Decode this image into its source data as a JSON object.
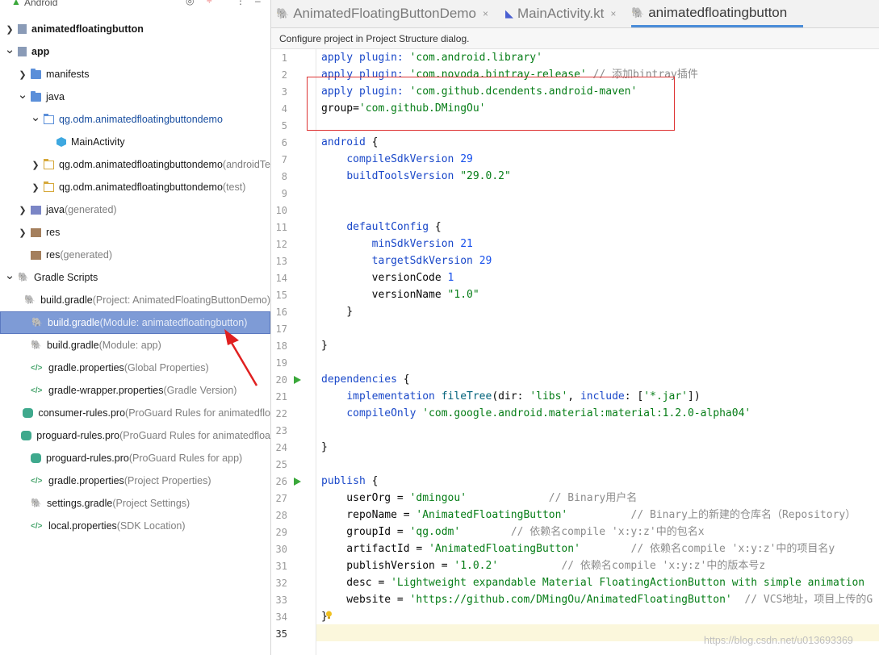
{
  "sidebar": {
    "header": "Android",
    "items": [
      {
        "label": "animatedfloatingbutton",
        "suffix": "",
        "arrow": ">",
        "icon": "module-icon",
        "bold": true
      },
      {
        "label": "app",
        "suffix": "",
        "arrow": "v",
        "icon": "module-icon",
        "bold": true
      },
      {
        "label": "manifests",
        "suffix": "",
        "arrow": ">",
        "icon": "folder-icon"
      },
      {
        "label": "java",
        "suffix": "",
        "arrow": "v",
        "icon": "folder-icon"
      },
      {
        "label": "qg.odm.animatedfloatingbuttondemo",
        "suffix": "",
        "arrow": "v",
        "icon": "package-icon",
        "blue": true
      },
      {
        "label": "MainActivity",
        "suffix": "",
        "arrow": "",
        "icon": "class-icon"
      },
      {
        "label": "qg.odm.animatedfloatingbuttondemo",
        "suffix": " (androidTe",
        "arrow": ">",
        "icon": "package-icon"
      },
      {
        "label": "qg.odm.animatedfloatingbuttondemo",
        "suffix": " (test)",
        "arrow": ">",
        "icon": "package-icon"
      },
      {
        "label": "java",
        "suffix": " (generated)",
        "arrow": ">",
        "icon": "folder-icon"
      },
      {
        "label": "res",
        "suffix": "",
        "arrow": ">",
        "icon": "res-folder-icon"
      },
      {
        "label": "res",
        "suffix": " (generated)",
        "arrow": "",
        "icon": "res-folder-icon"
      },
      {
        "label": "Gradle Scripts",
        "suffix": "",
        "arrow": "v",
        "icon": "gradle-icon"
      },
      {
        "label": "build.gradle",
        "suffix": " (Project: AnimatedFloatingButtonDemo)",
        "arrow": "",
        "icon": "gradle-icon"
      },
      {
        "label": "build.gradle",
        "suffix": " (Module: animatedfloatingbutton)",
        "arrow": "",
        "icon": "gradle-icon",
        "selected": true
      },
      {
        "label": "build.gradle",
        "suffix": " (Module: app)",
        "arrow": "",
        "icon": "gradle-icon"
      },
      {
        "label": "gradle.properties",
        "suffix": " (Global Properties)",
        "arrow": "",
        "icon": "properties-icon"
      },
      {
        "label": "gradle-wrapper.properties",
        "suffix": " (Gradle Version)",
        "arrow": "",
        "icon": "properties-icon"
      },
      {
        "label": "consumer-rules.pro",
        "suffix": " (ProGuard Rules for animatedflo",
        "arrow": "",
        "icon": "proguard-icon"
      },
      {
        "label": "proguard-rules.pro",
        "suffix": " (ProGuard Rules for animatedfloa",
        "arrow": "",
        "icon": "proguard-icon"
      },
      {
        "label": "proguard-rules.pro",
        "suffix": " (ProGuard Rules for app)",
        "arrow": "",
        "icon": "proguard-icon"
      },
      {
        "label": "gradle.properties",
        "suffix": " (Project Properties)",
        "arrow": "",
        "icon": "properties-icon"
      },
      {
        "label": "settings.gradle",
        "suffix": " (Project Settings)",
        "arrow": "",
        "icon": "gradle-icon"
      },
      {
        "label": "local.properties",
        "suffix": " (SDK Location)",
        "arrow": "",
        "icon": "properties-icon"
      }
    ]
  },
  "tabs": [
    {
      "label": "AnimatedFloatingButtonDemo",
      "icon": "gradle-icon",
      "active": false,
      "close": "×"
    },
    {
      "label": "MainActivity.kt",
      "icon": "kotlin-icon",
      "active": false,
      "close": "×"
    },
    {
      "label": "animatedfloatingbutton",
      "icon": "gradle-icon",
      "active": true,
      "close": ""
    }
  ],
  "hint": "Configure project in Project Structure dialog.",
  "editor": {
    "current_line": 35,
    "lines": [
      [
        [
          "kw",
          "apply plugin: "
        ],
        [
          "str",
          "'com.android.library'"
        ]
      ],
      [
        [
          "kw",
          "apply plugin: "
        ],
        [
          "str",
          "'com.novoda.bintray-release'"
        ],
        [
          "cmt",
          " // 添加bintray插件"
        ]
      ],
      [
        [
          "kw",
          "apply plugin: "
        ],
        [
          "str",
          "'com.github.dcendents.android-maven'"
        ]
      ],
      [
        [
          "",
          "group="
        ],
        [
          "str",
          "'com.github.DMingOu'"
        ]
      ],
      [],
      [
        [
          "kw",
          "android"
        ],
        [
          "",
          " {"
        ]
      ],
      [
        [
          "",
          "    "
        ],
        [
          "kw",
          "compileSdkVersion "
        ],
        [
          "num",
          "29"
        ]
      ],
      [
        [
          "",
          "    "
        ],
        [
          "kw",
          "buildToolsVersion "
        ],
        [
          "str",
          "\"29.0.2\""
        ]
      ],
      [],
      [],
      [
        [
          "",
          "    "
        ],
        [
          "kw",
          "defaultConfig"
        ],
        [
          "",
          " {"
        ]
      ],
      [
        [
          "",
          "        "
        ],
        [
          "kw",
          "minSdkVersion "
        ],
        [
          "num",
          "21"
        ]
      ],
      [
        [
          "",
          "        "
        ],
        [
          "kw",
          "targetSdkVersion "
        ],
        [
          "num",
          "29"
        ]
      ],
      [
        [
          "",
          "        versionCode "
        ],
        [
          "num",
          "1"
        ]
      ],
      [
        [
          "",
          "        versionName "
        ],
        [
          "str",
          "\"1.0\""
        ]
      ],
      [
        [
          "",
          "    }"
        ]
      ],
      [],
      [
        [
          "",
          "}"
        ]
      ],
      [],
      [
        [
          "kw",
          "dependencies"
        ],
        [
          "",
          " {"
        ]
      ],
      [
        [
          "",
          "    "
        ],
        [
          "kw",
          "implementation "
        ],
        [
          "fn",
          "fileTree"
        ],
        [
          "",
          "(dir: "
        ],
        [
          "str",
          "'libs'"
        ],
        [
          "",
          ", "
        ],
        [
          "kw",
          "include"
        ],
        [
          "",
          ": ["
        ],
        [
          "str",
          "'*.jar'"
        ],
        [
          "",
          "])"
        ]
      ],
      [
        [
          "",
          "    "
        ],
        [
          "kw",
          "compileOnly "
        ],
        [
          "str",
          "'com.google.android.material:material:1.2.0-alpha04'"
        ]
      ],
      [],
      [
        [
          "",
          "}"
        ]
      ],
      [],
      [
        [
          "kw",
          "publish"
        ],
        [
          "",
          " {"
        ]
      ],
      [
        [
          "",
          "    userOrg = "
        ],
        [
          "str",
          "'dmingou'"
        ],
        [
          "cmt",
          "             // Binary用户名"
        ]
      ],
      [
        [
          "",
          "    repoName = "
        ],
        [
          "str",
          "'AnimatedFloatingButton'"
        ],
        [
          "cmt",
          "          // Binary上的新建的仓库名（Repository）"
        ]
      ],
      [
        [
          "",
          "    groupId = "
        ],
        [
          "str",
          "'qg.odm'"
        ],
        [
          "cmt",
          "        // 依赖名compile 'x:y:z'中的包名x"
        ]
      ],
      [
        [
          "",
          "    artifactId = "
        ],
        [
          "str",
          "'AnimatedFloatingButton'"
        ],
        [
          "cmt",
          "        // 依赖名compile 'x:y:z'中的项目名y"
        ]
      ],
      [
        [
          "",
          "    publishVersion = "
        ],
        [
          "str",
          "'1.0.2'"
        ],
        [
          "cmt",
          "          // 依赖名compile 'x:y:z'中的版本号z"
        ]
      ],
      [
        [
          "",
          "    desc = "
        ],
        [
          "str",
          "'Lightweight expandable Material FloatingActionButton with simple animation"
        ]
      ],
      [
        [
          "",
          "    website = "
        ],
        [
          "str",
          "'https://github.com/DMingOu/AnimatedFloatingButton'"
        ],
        [
          "cmt",
          "  // VCS地址，项目上传的G"
        ]
      ],
      [
        [
          "",
          "}"
        ]
      ],
      []
    ],
    "run_lines": [
      20,
      26
    ]
  },
  "watermark": "https://blog.csdn.net/u013693369"
}
